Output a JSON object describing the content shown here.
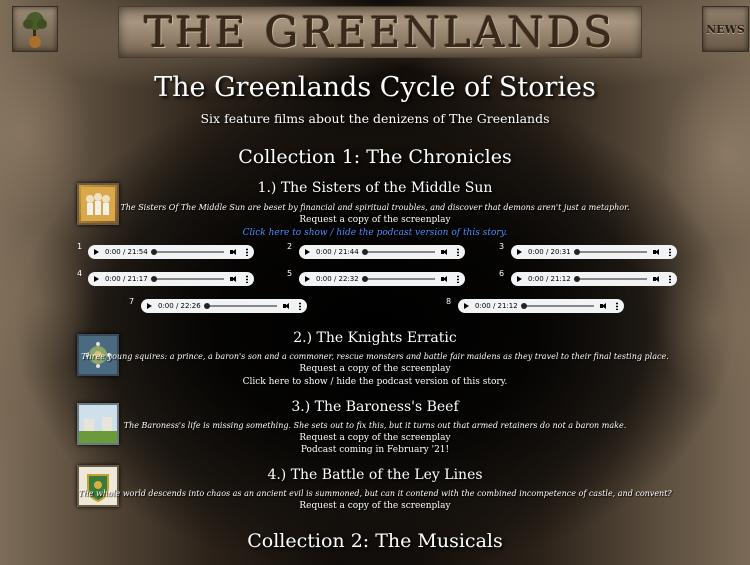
{
  "header": {
    "banner": "THE GREENLANDS",
    "news": "NEWS"
  },
  "page": {
    "title": "The Greenlands Cycle of Stories",
    "subtitle": "Six feature films about the denizens of The Greenlands"
  },
  "collections": [
    {
      "title": "Collection 1: The Chronicles"
    },
    {
      "title": "Collection 2: The Musicals"
    }
  ],
  "stories": [
    {
      "title": "1.) The Sisters of the Middle Sun",
      "desc": "The Sisters Of The Middle Sun are beset by financial and spiritual troubles, and discover that demons aren't just a metaphor.",
      "screenplay": "Request a copy of the screenplay",
      "podcast": "Click here to show / hide the podcast version of this story."
    },
    {
      "title": "2.) The Knights Erratic",
      "desc": "Three young squires: a prince, a baron's son and a commoner, rescue monsters and battle fair maidens as they travel to their final testing place.",
      "screenplay": "Request a copy of the screenplay",
      "podcast": "Click here to show / hide the podcast version of this story."
    },
    {
      "title": "3.) The Baroness's Beef",
      "desc": "The Baroness's life is missing something. She sets out to fix this, but it turns out that armed retainers do not a baron make.",
      "screenplay": "Request a copy of the screenplay",
      "podcast": "Podcast coming in February '21!"
    },
    {
      "title": "4.) The Battle of the Ley Lines",
      "desc": "The whole world descends into chaos as an ancient evil is summoned, but can it contend with the combined incompetence of castle, and convent?",
      "screenplay": "Request a copy of the screenplay"
    }
  ],
  "players": [
    {
      "num": "1",
      "time": "0:00 / 21:54"
    },
    {
      "num": "2",
      "time": "0:00 / 21:44"
    },
    {
      "num": "3",
      "time": "0:00 / 20:31"
    },
    {
      "num": "4",
      "time": "0:00 / 21:17"
    },
    {
      "num": "5",
      "time": "0:00 / 22:32"
    },
    {
      "num": "6",
      "time": "0:00 / 21:12"
    },
    {
      "num": "7",
      "time": "0:00 / 22:26"
    },
    {
      "num": "8",
      "time": "0:00 / 21:12"
    }
  ],
  "icons": {
    "logo": "tree-icon",
    "thumb1": "sisters-portrait-icon",
    "thumb2": "knights-emblem-icon",
    "thumb3": "castle-icon",
    "thumb4": "heraldic-shield-icon"
  }
}
